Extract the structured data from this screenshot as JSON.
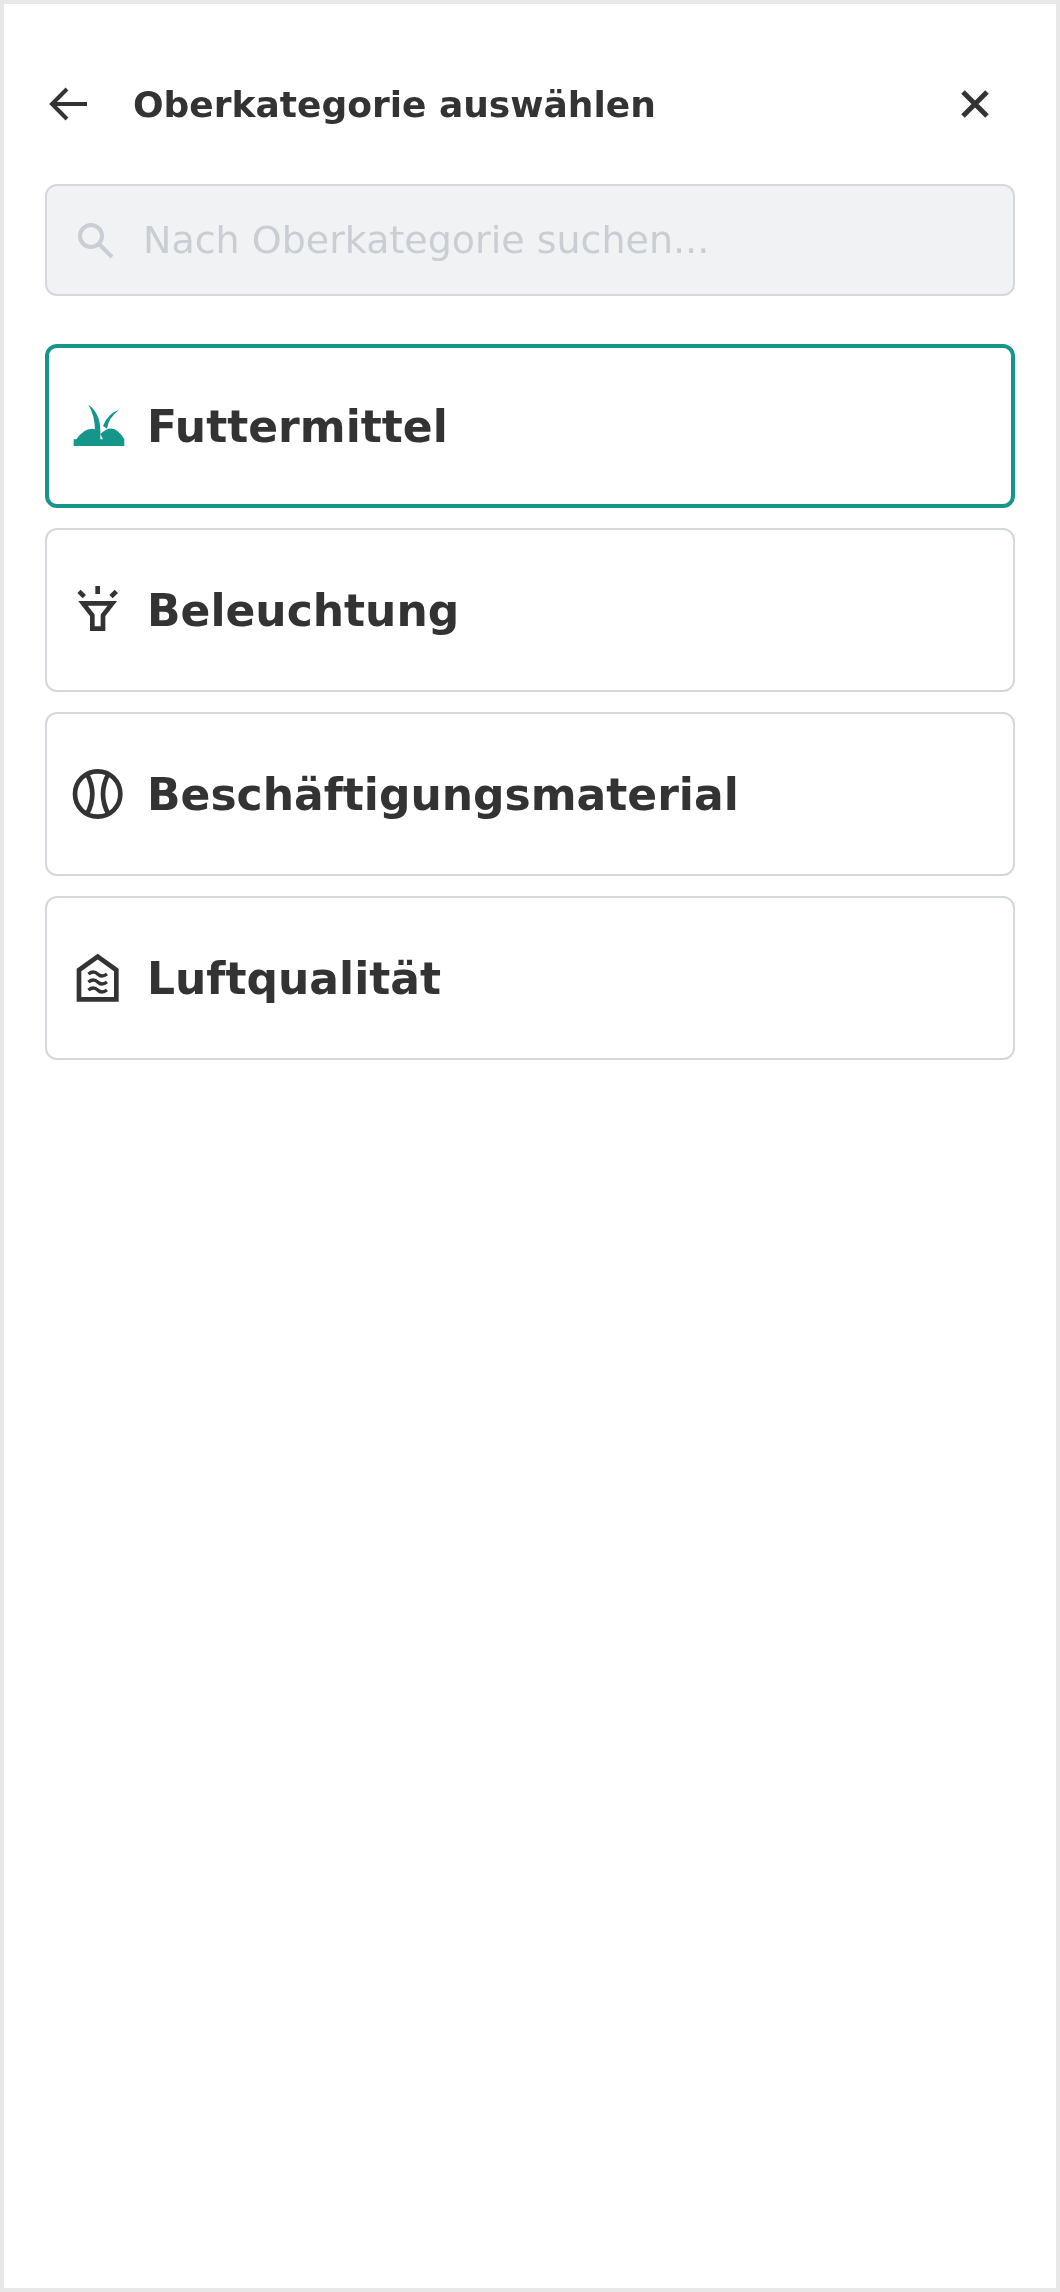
{
  "header": {
    "title": "Oberkategorie auswählen"
  },
  "search": {
    "placeholder": "Nach Oberkategorie suchen..."
  },
  "categories": [
    {
      "label": "Futtermittel",
      "kind": "grass",
      "selected": true
    },
    {
      "label": "Beleuchtung",
      "kind": "lamp",
      "selected": false
    },
    {
      "label": "Beschäftigungsmaterial",
      "kind": "ball",
      "selected": false
    },
    {
      "label": "Luftqualität",
      "kind": "air",
      "selected": false
    }
  ]
}
